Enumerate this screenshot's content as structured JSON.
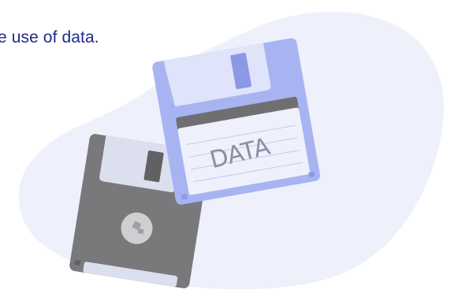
{
  "caption": "e use of data.",
  "illustration": {
    "subject": "floppy-disks",
    "label_text": "DATA",
    "colors": {
      "caption_text": "#1f2a8a",
      "background_blob": "#eef0fb",
      "front_disk_body": "#a8b4f2",
      "front_disk_dark": "#8c98e4",
      "front_disk_shutter": "#dfe4fb",
      "front_disk_label": "#eef0fc",
      "front_disk_band": "#6f6f72",
      "back_disk_body": "#79797c",
      "back_disk_dark": "#616164",
      "back_disk_shutter": "#dcdfee",
      "hub": "#cfcfd2",
      "hub_detail": "#a0a0a4"
    }
  }
}
